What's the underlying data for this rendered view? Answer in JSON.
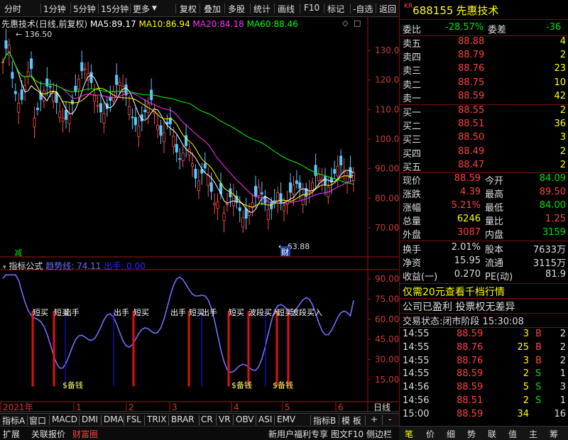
{
  "toolbar": {
    "items": [
      "分时",
      "1分钟",
      "5分钟",
      "15分钟",
      "更多",
      "复权",
      "叠加",
      "多股",
      "统计",
      "画线",
      "F10",
      "标记",
      "-自选",
      "返回"
    ]
  },
  "main_chart": {
    "stock_label": "先惠技术",
    "mode_label": "(日线,前复权)",
    "ma": [
      {
        "label": "MA5:",
        "value": "89.17",
        "color": "#ffffff"
      },
      {
        "label": "MA10:",
        "value": "86.94",
        "color": "#ffff00"
      },
      {
        "label": "MA20:",
        "value": "84.18",
        "color": "#ff33ff"
      },
      {
        "label": "MA60:",
        "value": "88.46",
        "color": "#00ff00"
      }
    ],
    "y_ticks": [
      "130.0",
      "120.0",
      "110.0",
      "100.0",
      "90.00",
      "80.00",
      "70.00"
    ],
    "high_label": "136.50",
    "low_label": "63.88",
    "annot_jian": "减",
    "annot_cai": "财"
  },
  "indicator": {
    "title": "指标公式",
    "line_label": "趋势线:",
    "line_value": "74.11",
    "sell_label": "出手:",
    "sell_value": "0.00",
    "y_ticks": [
      "90.00",
      "75.00",
      "60.00",
      "45.00",
      "30.00",
      "15.00"
    ],
    "signals_sell": [
      {
        "text": "短买"
      },
      {
        "text": "短买"
      },
      {
        "text": "出手"
      },
      {
        "text": "出手"
      },
      {
        "text": "短买"
      },
      {
        "text": "出手"
      },
      {
        "text": "短买"
      },
      {
        "text": "出手"
      },
      {
        "text": "短买"
      },
      {
        "text": "波段买入"
      },
      {
        "text": "短买"
      },
      {
        "text": "波段买入"
      }
    ],
    "signals_bottom": [
      {
        "text": "$备钱"
      },
      {
        "text": "$备钱"
      },
      {
        "text": "$备钱"
      }
    ]
  },
  "x_axis": {
    "labels": [
      "2021年",
      "1",
      "2",
      "3",
      "4",
      "5",
      "6"
    ],
    "period": "日线"
  },
  "tabs": [
    "指标A",
    "窗口",
    "MACD",
    "DMI",
    "DMA",
    "FSL",
    "TRIX",
    "BRAR",
    "CR",
    "VR",
    "OBV",
    "ASI",
    "EMV",
    "指标B",
    "模 板",
    "+",
    "-"
  ],
  "status": {
    "left": [
      "扩展",
      "关联报价",
      "财富圈"
    ],
    "right": [
      "新用户福利专享",
      "图文F10",
      "侧边栏"
    ]
  },
  "quote": {
    "market_tag": "KR",
    "code": "688155",
    "name": "先惠技术",
    "weibi_label": "委比",
    "weibi": "-28.57%",
    "weicha_label": "委差",
    "weicha": "-36",
    "asks": [
      {
        "label": "卖五",
        "price": "88.88",
        "vol": "4"
      },
      {
        "label": "卖四",
        "price": "88.79",
        "vol": "2"
      },
      {
        "label": "卖三",
        "price": "88.76",
        "vol": "23"
      },
      {
        "label": "卖二",
        "price": "88.75",
        "vol": "10"
      },
      {
        "label": "卖一",
        "price": "88.59",
        "vol": "42"
      }
    ],
    "bids": [
      {
        "label": "买一",
        "price": "88.55",
        "vol": "2"
      },
      {
        "label": "买二",
        "price": "88.51",
        "vol": "36"
      },
      {
        "label": "买三",
        "price": "88.50",
        "vol": "3"
      },
      {
        "label": "买四",
        "price": "88.49",
        "vol": "2"
      },
      {
        "label": "买五",
        "price": "88.47",
        "vol": "2"
      }
    ],
    "stats": [
      {
        "l1": "现价",
        "v1": "88.59",
        "c1": "#ff4040",
        "l2": "今开",
        "v2": "84.09",
        "c2": "#00e000"
      },
      {
        "l1": "涨跌",
        "v1": "4.39",
        "c1": "#ff4040",
        "l2": "最高",
        "v2": "89.50",
        "c2": "#ff4040"
      },
      {
        "l1": "涨幅",
        "v1": "5.21%",
        "c1": "#ff4040",
        "l2": "最低",
        "v2": "84.00",
        "c2": "#00e000"
      },
      {
        "l1": "总量",
        "v1": "6246",
        "c1": "#ffff00",
        "l2": "量比",
        "v2": "1.25",
        "c2": "#ff4040"
      },
      {
        "l1": "外盘",
        "v1": "3087",
        "c1": "#ff4040",
        "l2": "内盘",
        "v2": "3159",
        "c2": "#00e000"
      }
    ],
    "fund": [
      {
        "l1": "换手",
        "v1": "2.01%",
        "l2": "股本",
        "v2": "7633万"
      },
      {
        "l1": "净资",
        "v1": "15.95",
        "l2": "流通",
        "v2": "3115万"
      },
      {
        "l1": "收益(一)",
        "v1": "0.270",
        "l2": "PE(动)",
        "v2": "81.9"
      }
    ],
    "promo": "仅需20元查看千档行情",
    "notice": "公司已盈利 投票权无差异",
    "trade_state_label": "交易状态:",
    "trade_state": "闭市阶段",
    "trade_time": "15:30:08",
    "ticks": [
      {
        "t": "14:55",
        "p": "88.59",
        "v": "3",
        "s": "B",
        "n": "2",
        "sc": "#ff4040"
      },
      {
        "t": "14:55",
        "p": "88.76",
        "v": "25",
        "s": "B",
        "n": "2",
        "sc": "#ff4040"
      },
      {
        "t": "14:55",
        "p": "88.76",
        "v": "3",
        "s": "B",
        "n": "2",
        "sc": "#ff4040"
      },
      {
        "t": "14:55",
        "p": "88.59",
        "v": "2",
        "s": "S",
        "n": "1",
        "sc": "#00e000"
      },
      {
        "t": "14:56",
        "p": "88.59",
        "v": "5",
        "s": "S",
        "n": "3",
        "sc": "#00e000"
      },
      {
        "t": "14:56",
        "p": "88.51",
        "v": "2",
        "s": "S",
        "n": "1",
        "sc": "#00e000"
      },
      {
        "t": "15:00",
        "p": "88.59",
        "v": "34",
        "s": "",
        "n": "16",
        "sc": "#ffffff"
      }
    ]
  },
  "right_tabs": [
    "笔",
    "价",
    "细",
    "势",
    "联",
    "值",
    "主",
    "筹"
  ]
}
